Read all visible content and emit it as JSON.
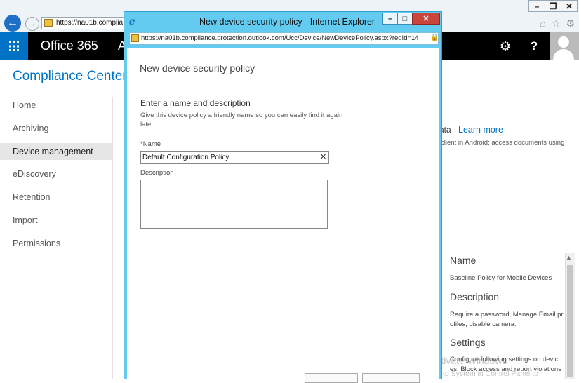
{
  "browser": {
    "address": "https://na01b.complia",
    "window_controls": [
      "–",
      "❐",
      "✕"
    ],
    "tool_icons": [
      "⌂",
      "☆",
      "⚙"
    ]
  },
  "office": {
    "app_title": "Office 365",
    "app_title_partial": "A",
    "gear_icon": "⚙",
    "help_label": "?",
    "waffle_icon": "⋮⋮⋮"
  },
  "page": {
    "title": "Compliance Center",
    "nav": [
      {
        "label": "Home"
      },
      {
        "label": "Archiving"
      },
      {
        "label": "Device management",
        "active": true
      },
      {
        "label": "eDiscovery"
      },
      {
        "label": "Retention"
      },
      {
        "label": "Import"
      },
      {
        "label": "Permissions"
      }
    ],
    "bg_fragment": "ata",
    "learn_more": "Learn more",
    "bg_client_text": "client in Android; access documents using"
  },
  "details": {
    "name_heading": "Name",
    "name_value": "Baseline Policy for Mobile Devices",
    "description_heading": "Description",
    "description_value": "Require a password, Manage Email pr ofiles, disable camera.",
    "settings_heading": "Settings",
    "settings_value": "Configure following settings on devic es, Block access and report violations"
  },
  "watermark": {
    "line1": "Activate Windows",
    "line2": "Go to System in Control Panel to"
  },
  "popup": {
    "title": "New device security policy - Internet Explorer",
    "address": "https://na01b.compliance.protection.outlook.com/Ucc/Device/NewDevicePolicy.aspx?reqId=14",
    "controls": [
      "–",
      "□",
      "✕"
    ],
    "heading": "New device security policy",
    "subheading": "Enter a name and description",
    "help_text": "Give this device policy a friendly name so you can easily find it again later.",
    "name_label": "*Name",
    "name_value": "Default Configuration Policy",
    "description_label": "Description",
    "description_value": ""
  }
}
